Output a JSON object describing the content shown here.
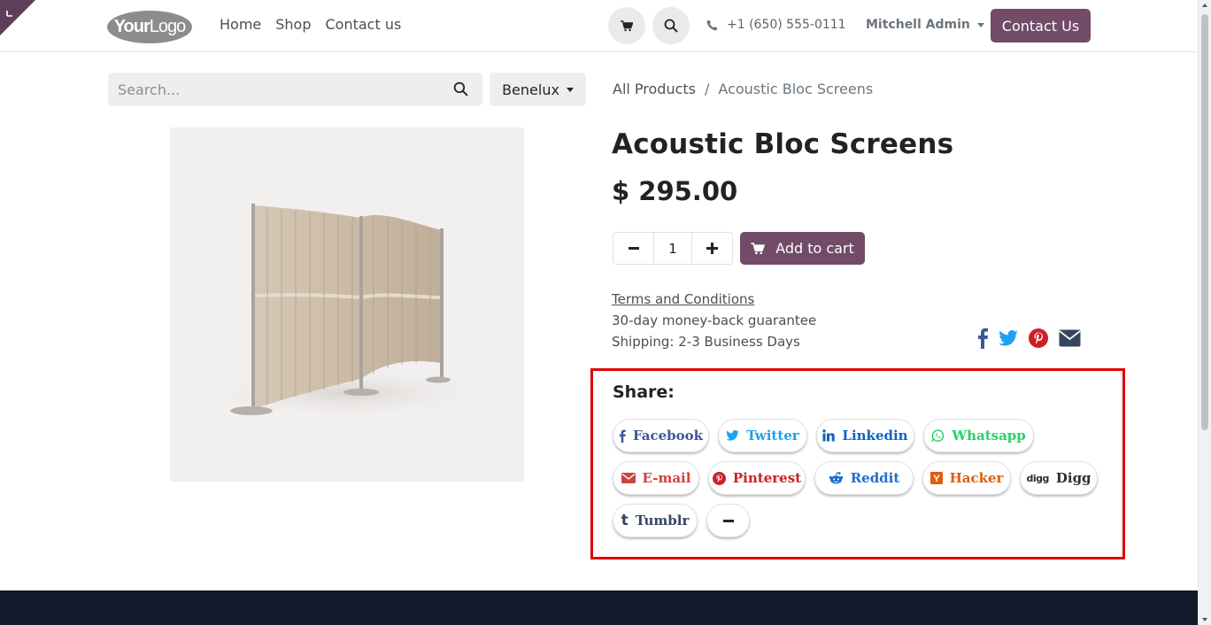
{
  "header": {
    "logo": "YourLogo",
    "nav": [
      "Home",
      "Shop",
      "Contact us"
    ],
    "phone": "+1 (650) 555-0111",
    "user": "Mitchell Admin",
    "contact_button": "Contact Us"
  },
  "toolbar": {
    "search_placeholder": "Search...",
    "pricelist": "Benelux"
  },
  "breadcrumb": {
    "parent": "All Products",
    "separator": "/",
    "current": "Acoustic Bloc Screens"
  },
  "product": {
    "name": "Acoustic Bloc Screens",
    "price": "$ 295.00",
    "quantity": "1",
    "add_to_cart": "Add to cart",
    "terms_link": "Terms and Conditions",
    "guarantee": "30-day money-back guarantee",
    "shipping": "Shipping: 2-3 Business Days"
  },
  "share": {
    "label": "Share:",
    "buttons": [
      {
        "label": "Facebook",
        "icon": "facebook-icon",
        "color": "#3b5998"
      },
      {
        "label": "Twitter",
        "icon": "twitter-icon",
        "color": "#1da1f2"
      },
      {
        "label": "Linkedin",
        "icon": "linkedin-icon",
        "color": "#0a66c2"
      },
      {
        "label": "Whatsapp",
        "icon": "whatsapp-icon",
        "color": "#25d366"
      },
      {
        "label": "E-mail",
        "icon": "envelope-icon",
        "color": "#d0433c"
      },
      {
        "label": "Pinterest",
        "icon": "pinterest-icon",
        "color": "#cb2027"
      },
      {
        "label": "Reddit",
        "icon": "reddit-icon",
        "color": "#1f6fcf"
      },
      {
        "label": "Hacker",
        "icon": "hacker-news-icon",
        "color": "#e05d0c"
      },
      {
        "label": "Digg",
        "icon": "digg-icon",
        "color": "#2f2f2f"
      },
      {
        "label": "Tumblr",
        "icon": "tumblr-icon",
        "color": "#35465c"
      },
      {
        "label": "",
        "icon": "minus-icon",
        "color": "#212529"
      }
    ]
  },
  "colors": {
    "brand": "#714b67",
    "highlight_border": "#e00000",
    "footer": "#111a2b"
  }
}
